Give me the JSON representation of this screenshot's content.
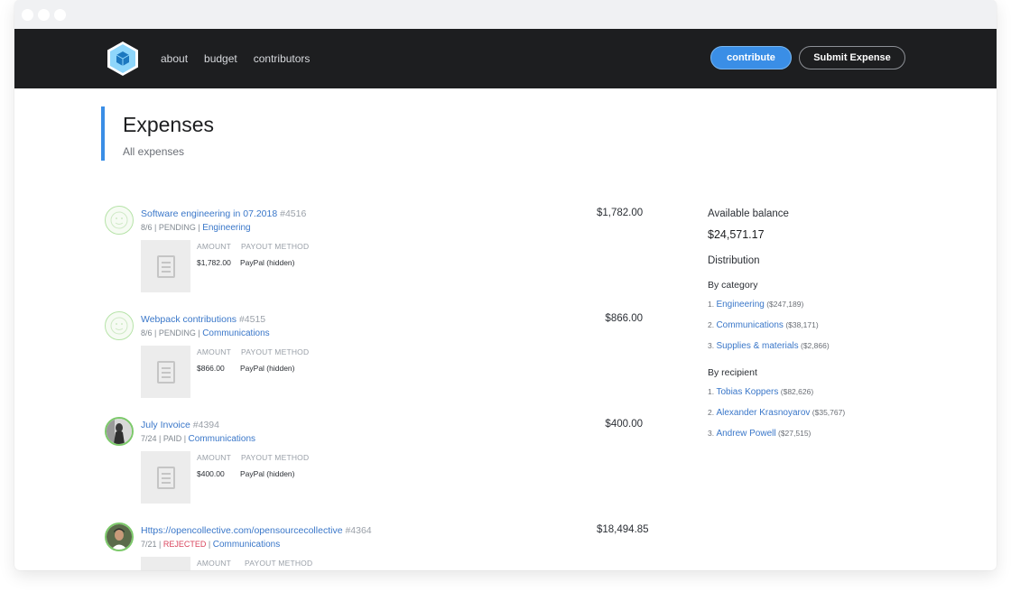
{
  "nav": {
    "links": [
      "about",
      "budget",
      "contributors"
    ],
    "contribute_label": "contribute",
    "submit_label": "Submit Expense"
  },
  "header": {
    "title": "Expenses",
    "subtitle": "All expenses"
  },
  "expenses": [
    {
      "title": "Software engineering in 07.2018",
      "id": "#4516",
      "meta": "8/6 | PENDING | ",
      "category": "Engineering",
      "amount": "$1,782.00",
      "col_amount_label": "AMOUNT",
      "col_payout_label": "PAYOUT METHOD",
      "detail_amount": "$1,782.00",
      "detail_payout": "PayPal (hidden)"
    },
    {
      "title": "Webpack contributions",
      "id": "#4515",
      "meta": "8/6 | PENDING | ",
      "category": "Communications",
      "amount": "$866.00",
      "col_amount_label": "AMOUNT",
      "col_payout_label": "PAYOUT METHOD",
      "detail_amount": "$866.00",
      "detail_payout": "PayPal (hidden)"
    },
    {
      "title": "July Invoice",
      "id": "#4394",
      "meta": "7/24 | PAID | ",
      "category": "Communications",
      "amount": "$400.00",
      "col_amount_label": "AMOUNT",
      "col_payout_label": "PAYOUT METHOD",
      "detail_amount": "$400.00",
      "detail_payout": "PayPal (hidden)"
    },
    {
      "title": "Https://opencollective.com/opensourcecollective",
      "id": "#4364",
      "meta_date": "7/21 | ",
      "meta_status": "REJECTED",
      "meta_sep": " | ",
      "category": "Communications",
      "amount": "$18,494.85",
      "col_amount_label": "AMOUNT",
      "col_payout_label": "PAYOUT METHOD"
    }
  ],
  "sidebar": {
    "balance_label": "Available balance",
    "balance_value": "$24,571.17",
    "distribution_label": "Distribution",
    "by_category_label": "By category",
    "categories": [
      {
        "rank": "1. ",
        "name": "Engineering",
        "amount": "($247,189)"
      },
      {
        "rank": "2. ",
        "name": "Communications",
        "amount": "($38,171)"
      },
      {
        "rank": "3. ",
        "name": "Supplies & materials",
        "amount": "($2,866)"
      }
    ],
    "by_recipient_label": "By recipient",
    "recipients": [
      {
        "rank": "1. ",
        "name": "Tobias Koppers",
        "amount": "($82,626)"
      },
      {
        "rank": "2. ",
        "name": "Alexander Krasnoyarov",
        "amount": "($35,767)"
      },
      {
        "rank": "3. ",
        "name": "Andrew Powell",
        "amount": "($27,515)"
      }
    ]
  },
  "colors": {
    "accent": "#3a8ee6",
    "nav_bg": "#1d1e20",
    "link": "#3a77c9",
    "rejected": "#d9455d"
  }
}
